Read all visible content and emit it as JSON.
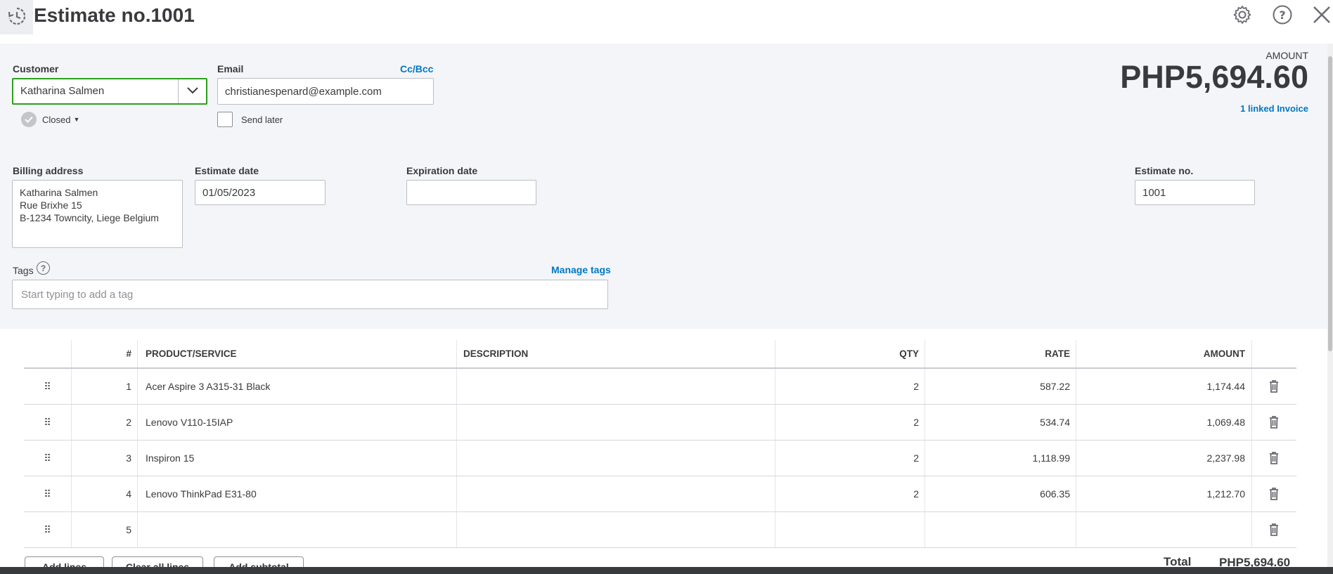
{
  "header": {
    "title": "Estimate no.1001"
  },
  "form": {
    "customer_label": "Customer",
    "customer_value": "Katharina Salmen",
    "status": "Closed",
    "email_label": "Email",
    "email_value": "christianespenard@example.com",
    "ccbcc_link": "Cc/Bcc",
    "send_later_label": "Send later",
    "amount_label": "AMOUNT",
    "amount_value": "PHP5,694.60",
    "linked_invoice": "1 linked Invoice",
    "billing_label": "Billing address",
    "billing_lines": [
      "Katharina Salmen",
      "Rue Brixhe 15",
      "B-1234 Towncity, Liege Belgium"
    ],
    "estimate_date_label": "Estimate date",
    "estimate_date_value": "01/05/2023",
    "expiration_label": "Expiration date",
    "expiration_value": "",
    "estimate_no_label": "Estimate no.",
    "estimate_no_value": "1001",
    "tags_label": "Tags",
    "manage_tags": "Manage tags",
    "tags_placeholder": "Start typing to add a tag"
  },
  "table": {
    "headers": {
      "num": "#",
      "product": "PRODUCT/SERVICE",
      "description": "DESCRIPTION",
      "qty": "QTY",
      "rate": "RATE",
      "amount": "AMOUNT"
    },
    "rows": [
      {
        "num": "1",
        "product": "Acer Aspire 3 A315-31 Black",
        "description": "",
        "qty": "2",
        "rate": "587.22",
        "amount": "1,174.44"
      },
      {
        "num": "2",
        "product": "Lenovo V110-15IAP",
        "description": "",
        "qty": "2",
        "rate": "534.74",
        "amount": "1,069.48"
      },
      {
        "num": "3",
        "product": "Inspiron 15",
        "description": "",
        "qty": "2",
        "rate": "1,118.99",
        "amount": "2,237.98"
      },
      {
        "num": "4",
        "product": "Lenovo ThinkPad E31-80",
        "description": "",
        "qty": "2",
        "rate": "606.35",
        "amount": "1,212.70"
      },
      {
        "num": "5",
        "product": "",
        "description": "",
        "qty": "",
        "rate": "",
        "amount": ""
      }
    ]
  },
  "actions": {
    "add_lines": "Add lines",
    "clear_all_lines": "Clear all lines",
    "add_subtotal": "Add subtotal"
  },
  "totals": {
    "label": "Total",
    "value": "PHP5,694.60"
  },
  "colors": {
    "accent_green": "#2ca01c",
    "link_blue": "#0077c5",
    "panel_bg": "#f4f5f8"
  }
}
